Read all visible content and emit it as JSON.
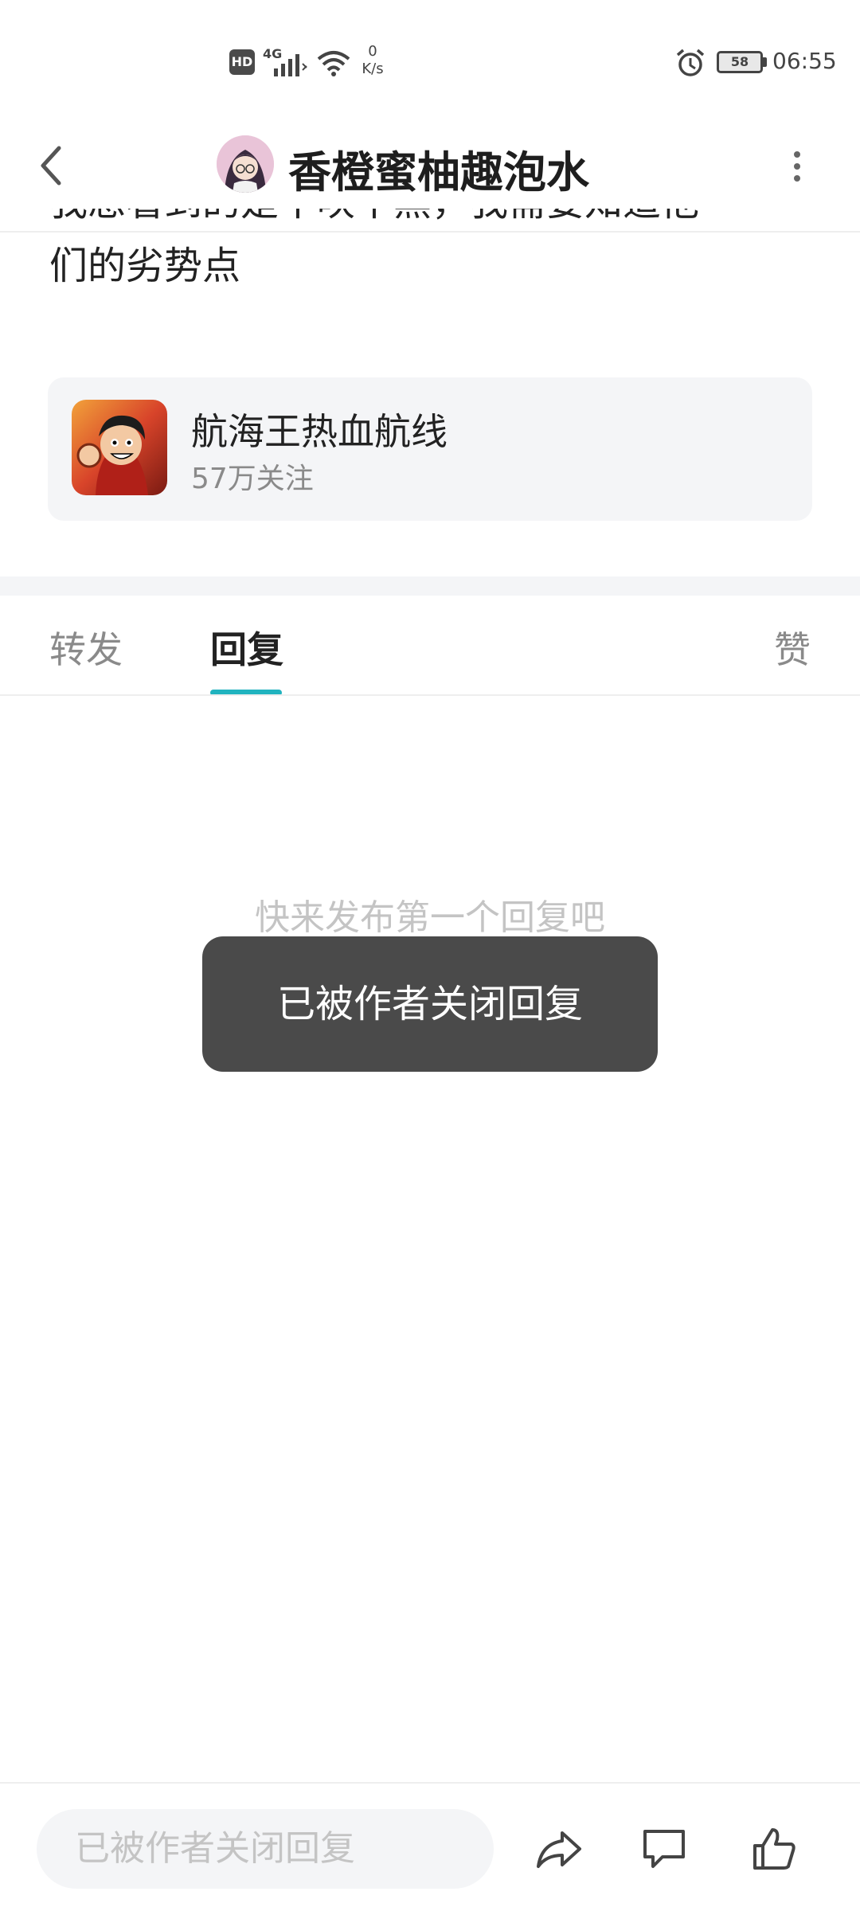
{
  "status_bar": {
    "hd": "HD",
    "network_type": "4G",
    "net_speed_value": "0",
    "net_speed_unit": "K/s",
    "battery": "58",
    "time": "06:55"
  },
  "header": {
    "title": "香橙蜜柚趣泡水"
  },
  "post": {
    "text_line_cut": "我想看到的是不吹不黑，我需要知道他",
    "text_line": "们的劣势点"
  },
  "game_card": {
    "name": "航海王热血航线",
    "followers": "57万关注"
  },
  "tabs": [
    {
      "label": "转发",
      "active": false
    },
    {
      "label": "回复",
      "active": true
    },
    {
      "label": "赞",
      "active": false
    }
  ],
  "empty_state": "快来发布第一个回复吧",
  "toast": "已被作者关闭回复",
  "bottom_bar": {
    "input_placeholder": "已被作者关闭回复"
  },
  "colors": {
    "accent": "#21b3bf",
    "toast_bg": "#4a4a4a",
    "card_bg": "#f4f5f7"
  }
}
